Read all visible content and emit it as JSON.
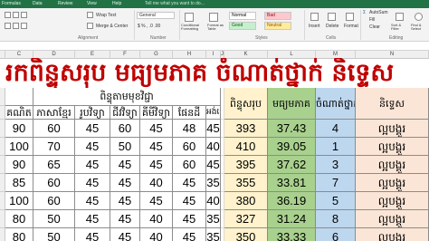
{
  "ribbon": {
    "tabs": [
      "Formulas",
      "Data",
      "Review",
      "View",
      "Help"
    ],
    "tell_me": "Tell me what you want to do...",
    "wrap_text": "Wrap Text",
    "merge_center": "Merge & Center",
    "number_format": "General",
    "conditional_formatting": "Conditional Formatting",
    "format_as_table": "Format as Table",
    "cell_styles": [
      "Normal",
      "Bad",
      "Good",
      "Neutral"
    ],
    "insert": "Insert",
    "delete": "Delete",
    "format": "Format",
    "autosum": "AutoSum",
    "fill": "Fill",
    "clear": "Clear",
    "sort_filter": "Sort & Filter",
    "find_select": "Find & Select",
    "group_alignment": "Alignment",
    "group_number": "Number",
    "group_styles": "Styles",
    "group_cells": "Cells",
    "group_editing": "Editing"
  },
  "column_letters": [
    "C",
    "D",
    "E",
    "F",
    "G",
    "H",
    "I",
    "J",
    "K",
    "L",
    "M",
    "N"
  ],
  "sheet": {
    "title": "រកពិន្ទុសរុប មធ្យមភាគ ចំណាត់ថ្នាក់ និទ្ទេស",
    "group_header": "ពិន្ទុតាមមុខវិជ្ជា",
    "subject_headers": [
      "គណិត",
      "ភាសាខ្មែរ",
      "រូបវិទ្យា",
      "ជីវវិទ្យា",
      "គីមីវិទ្យា",
      "ផែនដី",
      "អង់គ្លេស"
    ],
    "result_headers": [
      "ពិន្ទុសរុប",
      "មធ្យមភាគ",
      "ចំណាត់ថ្នាក់",
      "និទ្ទេស"
    ],
    "rows": [
      {
        "scores": [
          "90",
          "60",
          "45",
          "60",
          "45",
          "48",
          "45"
        ],
        "total": "393",
        "average": "37.43",
        "rank": "4",
        "grade": "ល្អបង្គួរ"
      },
      {
        "scores": [
          "100",
          "70",
          "45",
          "50",
          "45",
          "60",
          "40"
        ],
        "total": "410",
        "average": "39.05",
        "rank": "1",
        "grade": "ល្អបង្គួរ"
      },
      {
        "scores": [
          "90",
          "65",
          "45",
          "45",
          "45",
          "60",
          "45"
        ],
        "total": "395",
        "average": "37.62",
        "rank": "3",
        "grade": "ល្អបង្គួរ"
      },
      {
        "scores": [
          "85",
          "60",
          "45",
          "45",
          "40",
          "45",
          "35"
        ],
        "total": "355",
        "average": "33.81",
        "rank": "7",
        "grade": "ល្អបង្គួរ"
      },
      {
        "scores": [
          "100",
          "60",
          "45",
          "45",
          "45",
          "45",
          "40"
        ],
        "total": "380",
        "average": "36.19",
        "rank": "5",
        "grade": "ល្អបង្គួរ"
      },
      {
        "scores": [
          "80",
          "50",
          "45",
          "45",
          "40",
          "45",
          "35"
        ],
        "total": "327",
        "average": "31.24",
        "rank": "8",
        "grade": "ល្អបង្គួរ"
      },
      {
        "scores": [
          "80",
          "50",
          "45",
          "45",
          "40",
          "45",
          "35"
        ],
        "total": "350",
        "average": "33.33",
        "rank": "6",
        "grade": "ល្អបង្គួរ"
      }
    ]
  }
}
